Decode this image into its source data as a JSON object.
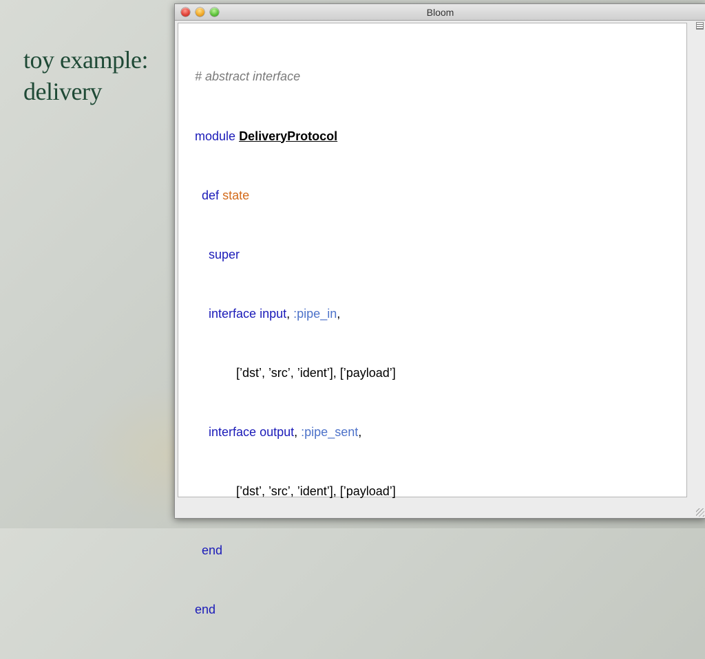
{
  "slide": {
    "title_line1": "toy example:",
    "title_line2": "delivery"
  },
  "window": {
    "title": "Bloom"
  },
  "colors": {
    "keyword": "#1a1ab8",
    "comment": "#7a7a7a",
    "method": "#d36a1a",
    "symbol": "#4d72c9",
    "slide_title": "#1f4a36"
  },
  "code": {
    "comment": "# abstract interface",
    "module_kw": "module",
    "module_name": "DeliveryProtocol",
    "def_kw": "def",
    "def_name": "state",
    "super_kw": "super",
    "interface_kw": "interface",
    "input_kw": "input",
    "output_kw": "output",
    "comma": ",",
    "pipe_in": ":pipe_in",
    "pipe_sent": ":pipe_sent",
    "schema1": "[’dst’, ’src’, ’ident’], [’payload’]",
    "schema2": "[’dst’, ’src’, ’ident’], [’payload’]",
    "end1": "end",
    "end2": "end"
  }
}
